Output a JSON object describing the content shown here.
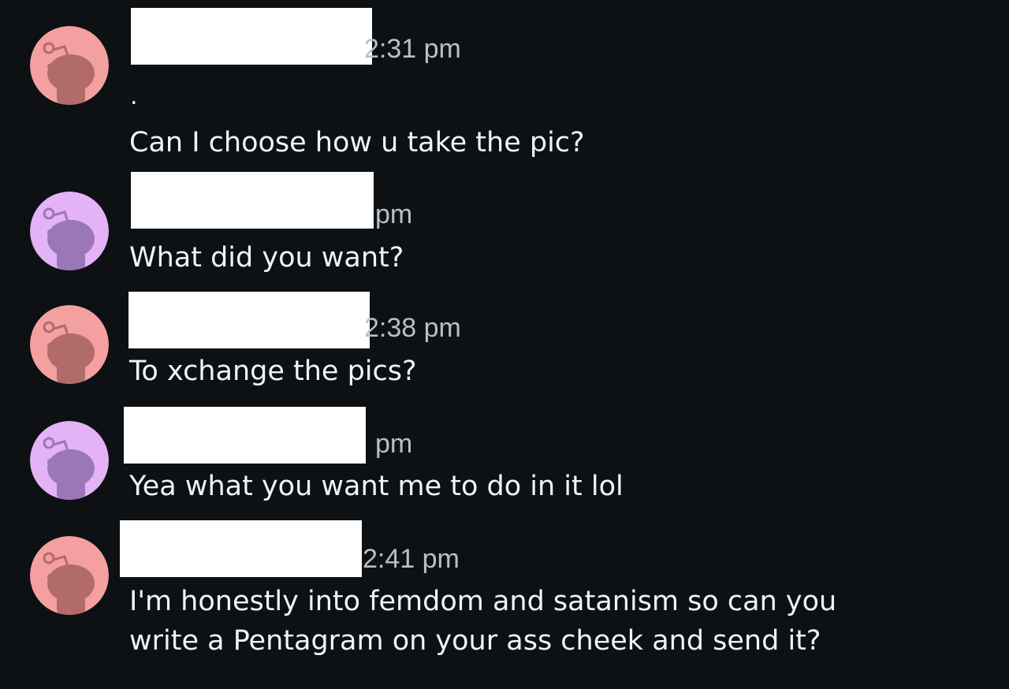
{
  "colors": {
    "background": "#0e1113",
    "text": "#f1f3f5",
    "timestamp": "#b7c0c7",
    "avatar_pink": "#f4a0a0",
    "avatar_pink_figure": "#b26b6b",
    "avatar_purple": "#e3b2f7",
    "avatar_purple_figure": "#9b77b8",
    "redaction": "#ffffff"
  },
  "messages": [
    {
      "avatar_icon": "snoo-avatar-pink-icon",
      "timestamp": "2:31 pm",
      "lines": [
        ".",
        "Can I choose how u take the pic?"
      ]
    },
    {
      "avatar_icon": "snoo-avatar-purple-icon",
      "timestamp": "pm",
      "lines": [
        "What did you want?"
      ]
    },
    {
      "avatar_icon": "snoo-avatar-pink-icon",
      "timestamp": "2:38 pm",
      "lines": [
        "To xchange the pics?"
      ]
    },
    {
      "avatar_icon": "snoo-avatar-purple-icon",
      "timestamp": "pm",
      "lines": [
        "Yea what you want me to do in it lol"
      ]
    },
    {
      "avatar_icon": "snoo-avatar-pink-icon",
      "timestamp": "2:41 pm",
      "lines": [
        "I'm honestly into femdom and satanism so can you",
        "write a Pentagram on your ass cheek and send it?"
      ]
    }
  ]
}
